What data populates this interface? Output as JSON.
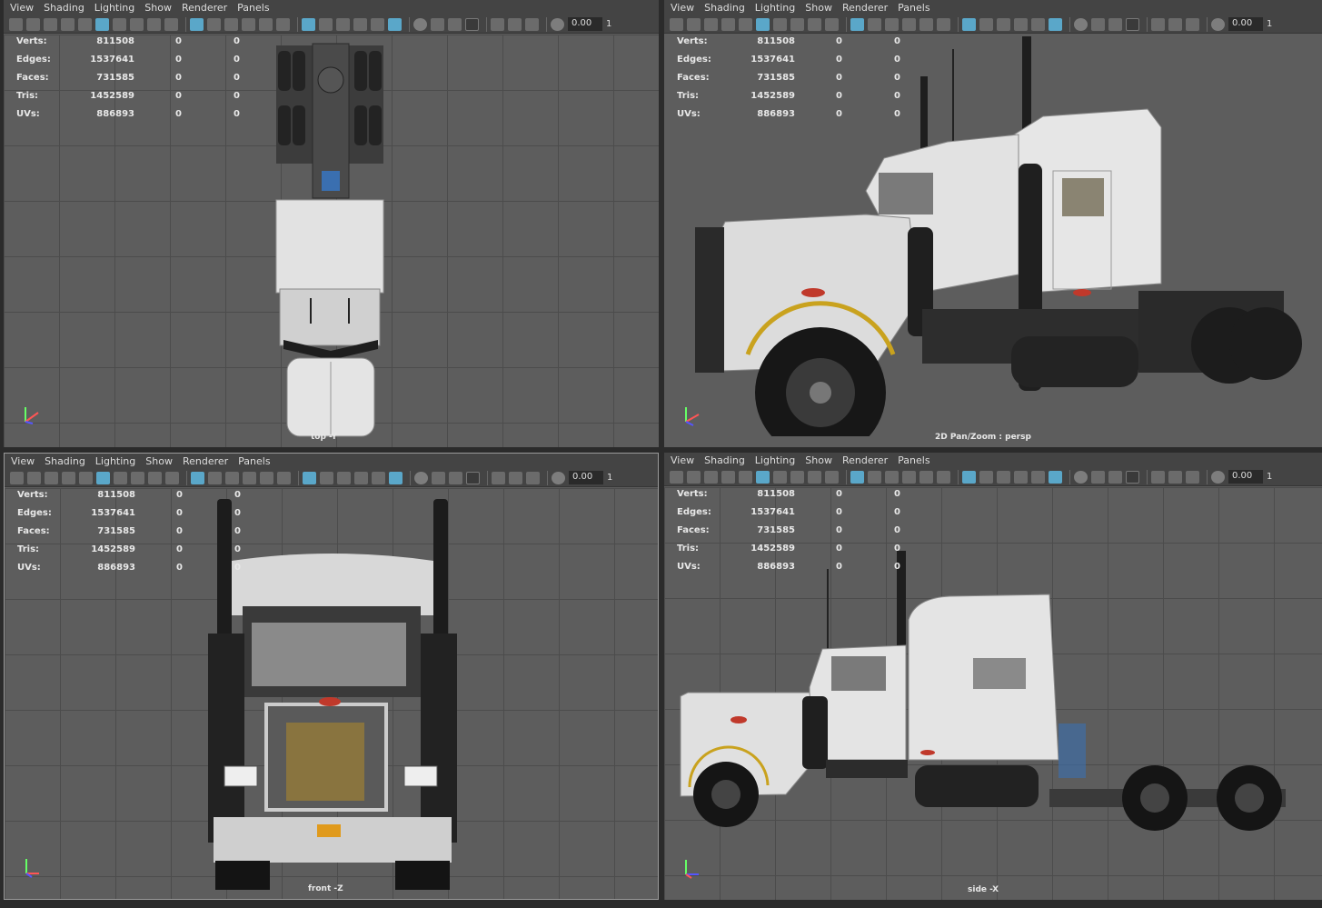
{
  "menu": [
    "View",
    "Shading",
    "Lighting",
    "Show",
    "Renderer",
    "Panels"
  ],
  "toolbar": {
    "value": "0.00",
    "trailing": "1"
  },
  "hud_labels": [
    "Verts:",
    "Edges:",
    "Faces:",
    "Tris:",
    "UVs:"
  ],
  "hud_values": [
    "811508",
    "1537641",
    "731585",
    "1452589",
    "886893"
  ],
  "hud_zero": "0",
  "panels": {
    "tl": {
      "camera": "top -Y"
    },
    "tr": {
      "camera": "2D Pan/Zoom : persp"
    },
    "bl": {
      "camera": "front -Z"
    },
    "br": {
      "camera": "side -X"
    }
  },
  "icons": [
    "camera-icon",
    "grid-icon",
    "wireframe-icon",
    "smooth-shade-icon",
    "xray-icon",
    "isolate-icon",
    "exposure-icon",
    "gamma-icon"
  ],
  "colors": {
    "panel_bg": "#5d5d5d",
    "grid": "#4c4c4c",
    "toolbar_bg": "#444444",
    "active_icon": "#5aa7c9",
    "truck_body": "#d9d9d9",
    "accent_red": "#c0392b"
  }
}
